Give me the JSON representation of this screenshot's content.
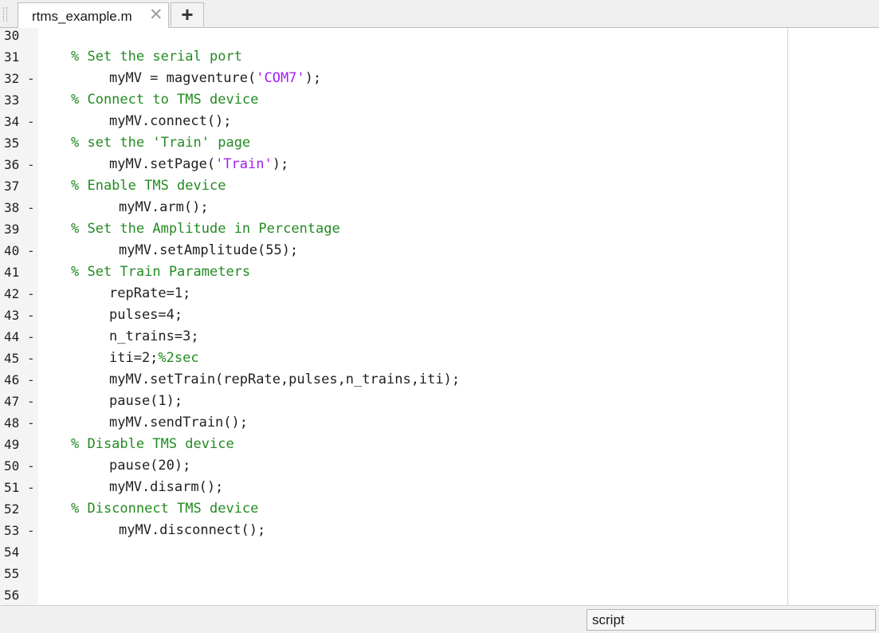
{
  "tabs": {
    "active_label": "rtms_example.m",
    "close_glyph": "✕",
    "new_tab_glyph": "+"
  },
  "status": {
    "mode": "script"
  },
  "code": [
    {
      "num": "30",
      "bp": "",
      "indent": 0,
      "tokens": []
    },
    {
      "num": "31",
      "bp": "",
      "indent": 4,
      "tokens": [
        {
          "t": "% Set the serial port",
          "c": "comment"
        }
      ]
    },
    {
      "num": "32",
      "bp": "-",
      "indent": 8,
      "tokens": [
        {
          "t": "myMV = magventure(",
          "c": "code"
        },
        {
          "t": "'COM7'",
          "c": "str"
        },
        {
          "t": ");",
          "c": "code"
        }
      ]
    },
    {
      "num": "33",
      "bp": "",
      "indent": 4,
      "tokens": [
        {
          "t": "% Connect to TMS device",
          "c": "comment"
        }
      ]
    },
    {
      "num": "34",
      "bp": "-",
      "indent": 8,
      "tokens": [
        {
          "t": "myMV.connect();",
          "c": "code"
        }
      ]
    },
    {
      "num": "35",
      "bp": "",
      "indent": 4,
      "tokens": [
        {
          "t": "% set the 'Train' page",
          "c": "comment"
        }
      ]
    },
    {
      "num": "36",
      "bp": "-",
      "indent": 8,
      "tokens": [
        {
          "t": "myMV.setPage(",
          "c": "code"
        },
        {
          "t": "'Train'",
          "c": "str"
        },
        {
          "t": ");",
          "c": "code"
        }
      ]
    },
    {
      "num": "37",
      "bp": "",
      "indent": 4,
      "tokens": [
        {
          "t": "% Enable TMS device",
          "c": "comment"
        }
      ]
    },
    {
      "num": "38",
      "bp": "-",
      "indent": 9,
      "tokens": [
        {
          "t": "myMV.arm();",
          "c": "code"
        }
      ]
    },
    {
      "num": "39",
      "bp": "",
      "indent": 4,
      "tokens": [
        {
          "t": "% Set the Amplitude in Percentage",
          "c": "comment"
        }
      ]
    },
    {
      "num": "40",
      "bp": "-",
      "indent": 9,
      "tokens": [
        {
          "t": "myMV.setAmplitude(55);",
          "c": "code"
        }
      ]
    },
    {
      "num": "41",
      "bp": "",
      "indent": 4,
      "tokens": [
        {
          "t": "% Set Train Parameters",
          "c": "comment"
        }
      ]
    },
    {
      "num": "42",
      "bp": "-",
      "indent": 8,
      "tokens": [
        {
          "t": "repRate=1;",
          "c": "code"
        }
      ]
    },
    {
      "num": "43",
      "bp": "-",
      "indent": 8,
      "tokens": [
        {
          "t": "pulses=4;",
          "c": "code"
        }
      ]
    },
    {
      "num": "44",
      "bp": "-",
      "indent": 8,
      "tokens": [
        {
          "t": "n_trains=3;",
          "c": "code"
        }
      ]
    },
    {
      "num": "45",
      "bp": "-",
      "indent": 8,
      "tokens": [
        {
          "t": "iti=2;",
          "c": "code"
        },
        {
          "t": "%2sec",
          "c": "comment"
        }
      ]
    },
    {
      "num": "46",
      "bp": "-",
      "indent": 8,
      "tokens": [
        {
          "t": "myMV.setTrain(repRate,pulses,n_trains,iti);",
          "c": "code"
        }
      ]
    },
    {
      "num": "47",
      "bp": "-",
      "indent": 8,
      "tokens": [
        {
          "t": "pause(1);",
          "c": "code"
        }
      ]
    },
    {
      "num": "48",
      "bp": "-",
      "indent": 8,
      "tokens": [
        {
          "t": "myMV.sendTrain();",
          "c": "code"
        }
      ]
    },
    {
      "num": "49",
      "bp": "",
      "indent": 4,
      "tokens": [
        {
          "t": "% Disable TMS device",
          "c": "comment"
        }
      ]
    },
    {
      "num": "50",
      "bp": "-",
      "indent": 8,
      "tokens": [
        {
          "t": "pause(20);",
          "c": "code"
        }
      ]
    },
    {
      "num": "51",
      "bp": "-",
      "indent": 8,
      "tokens": [
        {
          "t": "myMV.disarm();",
          "c": "code"
        }
      ]
    },
    {
      "num": "52",
      "bp": "",
      "indent": 4,
      "tokens": [
        {
          "t": "% Disconnect TMS device",
          "c": "comment"
        }
      ]
    },
    {
      "num": "53",
      "bp": "-",
      "indent": 9,
      "tokens": [
        {
          "t": "myMV.disconnect();",
          "c": "code"
        }
      ]
    },
    {
      "num": "54",
      "bp": "",
      "indent": 0,
      "tokens": []
    },
    {
      "num": "55",
      "bp": "",
      "indent": 0,
      "tokens": []
    },
    {
      "num": "56",
      "bp": "",
      "indent": 0,
      "tokens": []
    }
  ]
}
